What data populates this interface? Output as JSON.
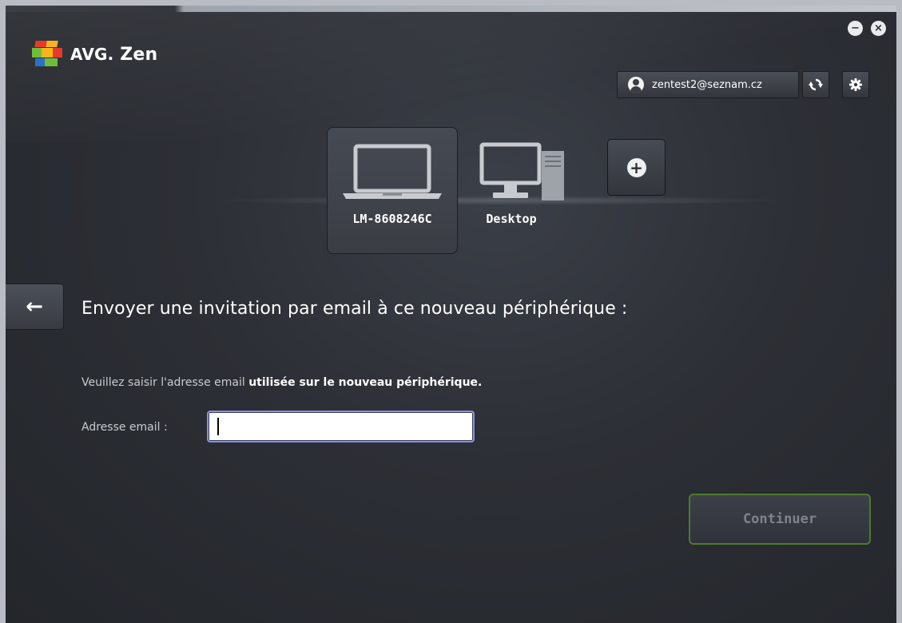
{
  "app": {
    "brand_prefix": "AVG.",
    "brand_name": "Zen"
  },
  "window_controls": {
    "minimize": "−",
    "close": "×"
  },
  "account": {
    "email": "zentest2@seznam.cz",
    "icons": {
      "user": "user-icon",
      "sync": "sync-icon",
      "settings": "gear-icon"
    }
  },
  "devices": [
    {
      "name": "LM-8608246C",
      "type": "laptop",
      "selected": true
    },
    {
      "name": "Desktop",
      "type": "desktop",
      "selected": false
    }
  ],
  "add_device": {
    "icon": "plus-icon"
  },
  "page": {
    "title": "Envoyer une invitation par email à ce nouveau périphérique :",
    "instruction_part1": "Veuillez saisir l'adresse email ",
    "instruction_part2": "utilisée sur le nouveau périphérique.",
    "email_label": "Adresse email :",
    "email_value": "",
    "continue_label": "Continuer"
  },
  "colors": {
    "background": "#2c2f35",
    "accent_green": "#4f7a2e",
    "input_focus": "#8d8fd6",
    "logo_red": "#e8392c",
    "logo_yellow": "#f7b51c",
    "logo_green": "#6dbf3a",
    "logo_blue": "#2d6fc6"
  }
}
